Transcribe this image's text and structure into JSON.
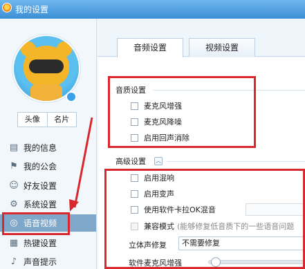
{
  "window": {
    "title": "我的设置"
  },
  "profile": {
    "tab_avatar": "头像",
    "tab_card": "名片"
  },
  "sidebar": {
    "items": [
      {
        "label": "我的信息",
        "icon": "id-card-icon"
      },
      {
        "label": "我的公会",
        "icon": "flag-icon"
      },
      {
        "label": "好友设置",
        "icon": "friends-icon"
      },
      {
        "label": "系统设置",
        "icon": "gear-icon"
      },
      {
        "label": "语音视频",
        "icon": "headset-icon",
        "active": true
      },
      {
        "label": "热键设置",
        "icon": "keyboard-icon"
      },
      {
        "label": "声音提示",
        "icon": "speaker-icon"
      }
    ]
  },
  "tabs": {
    "audio": "音频设置",
    "video": "视频设置"
  },
  "audio_quality": {
    "title": "音质设置",
    "options": [
      {
        "label": "麦克风增强",
        "checked": false
      },
      {
        "label": "麦克风降噪",
        "checked": false
      },
      {
        "label": "启用回声消除",
        "checked": false
      }
    ]
  },
  "advanced": {
    "title": "高级设置",
    "options": [
      {
        "label": "启用混响",
        "checked": false
      },
      {
        "label": "启用变声",
        "checked": false
      },
      {
        "label": "使用软件卡拉OK混音",
        "checked": false
      }
    ],
    "compat_mode": {
      "label": "兼容模式",
      "hint": "(能够修复低音质下的一些语音问题"
    },
    "stereo": {
      "label": "立体声修复",
      "value": "不需要修复"
    },
    "soft_mic_boost": {
      "label": "软件麦克风增强",
      "level": 0.03
    }
  },
  "colors": {
    "annotation": "#d9272e",
    "active_nav": "#7fa7c9",
    "titlebar": "#3c8fd6"
  }
}
